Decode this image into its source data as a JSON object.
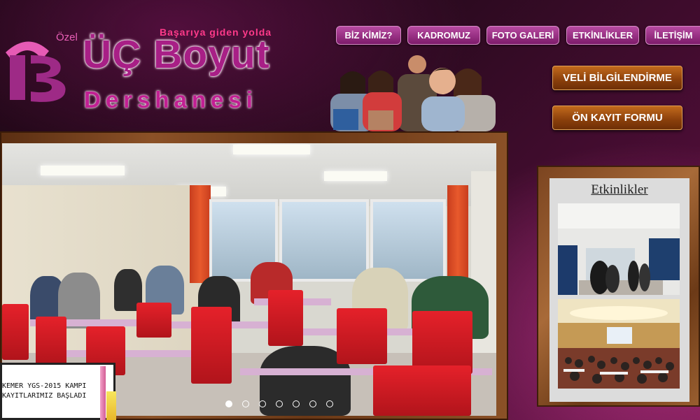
{
  "logo": {
    "prefix": "Özel",
    "name": "ÜÇ Boyut",
    "subtitle": "Dershanesi",
    "tagline": "Başarıya giden yolda",
    "mark_letter": "3B"
  },
  "nav": {
    "items": [
      {
        "label": "BİZ KİMİZ?"
      },
      {
        "label": "KADROMUZ"
      },
      {
        "label": "FOTO GALERİ"
      },
      {
        "label": "ETKİNLİKLER"
      },
      {
        "label": "İLETİŞİM"
      }
    ]
  },
  "side_buttons": {
    "veli": "VELİ BİLGİLENDİRME",
    "kayit": "ÖN KAYIT FORMU"
  },
  "slider": {
    "caption_line1": "KEMER YGS-2015 KAMPI",
    "caption_line2": "KAYITLARIMIZ BAŞLADI",
    "slide_count": 7,
    "active_slide": 1
  },
  "events": {
    "title": "Etkinlikler"
  },
  "colors": {
    "nav_purple": "#9a2f84",
    "logo_pink": "#c21f93",
    "button_brown": "#8a3f0b",
    "frame_wood": "#8b5127"
  }
}
